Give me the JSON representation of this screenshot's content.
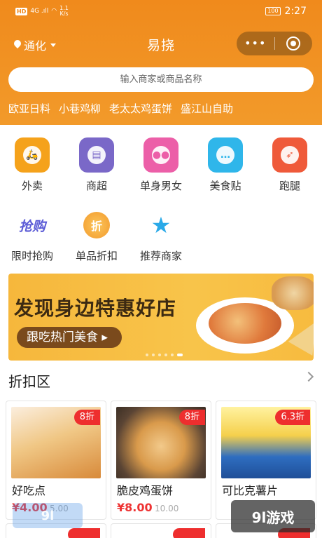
{
  "status_bar": {
    "hd": "HD",
    "signal": "4G .ıll",
    "speed_value": "1.1",
    "speed_unit": "K/s",
    "battery": "100",
    "time": "2:27"
  },
  "nav": {
    "location": "通化",
    "title": "易挠",
    "capsule_dots": "•••"
  },
  "search": {
    "placeholder": "输入商家或商品名称"
  },
  "hot_searches": [
    "欧亚日料",
    "小巷鸡柳",
    "老太太鸡蛋饼",
    "盛江山自助"
  ],
  "categories_row1": [
    {
      "label": "外卖",
      "icon": "scooter-icon",
      "color": "#f5a21b"
    },
    {
      "label": "商超",
      "icon": "store-icon",
      "color": "#7a68c8"
    },
    {
      "label": "单身男女",
      "icon": "couple-icon",
      "color": "#ec5fa8"
    },
    {
      "label": "美食贴",
      "icon": "chat-icon",
      "color": "#2fb6ea"
    },
    {
      "label": "跑腿",
      "icon": "runner-icon",
      "color": "#ef5a3a"
    }
  ],
  "categories_row2": [
    {
      "label": "限时抢购",
      "icon": "flash-sale-icon",
      "glyph": "抢购",
      "color": "#5b5bd6"
    },
    {
      "label": "单品折扣",
      "icon": "discount-badge-icon",
      "glyph": "折",
      "color": "#f6a53a"
    },
    {
      "label": "推荐商家",
      "icon": "ribbon-star-icon",
      "glyph": "★",
      "color": "#2aa9e8"
    }
  ],
  "banner": {
    "headline": "发现身边特惠好店",
    "button": "跟吃热门美食 ▸"
  },
  "section": {
    "title": "折扣区"
  },
  "products": [
    {
      "name": "好吃点",
      "discount": "8折",
      "price": "¥4.00",
      "original": "5.00"
    },
    {
      "name": "脆皮鸡蛋饼",
      "discount": "8折",
      "price": "¥8.00",
      "original": "10.00"
    },
    {
      "name": "可比克薯片",
      "discount": "6.3折",
      "price": "",
      "original": ""
    }
  ],
  "watermark": {
    "right": "9l游戏",
    "left": "9l"
  },
  "colors": {
    "brand_orange": "#f08a1c",
    "price_red": "#e33333",
    "tag_red": "#ee2e2e"
  }
}
